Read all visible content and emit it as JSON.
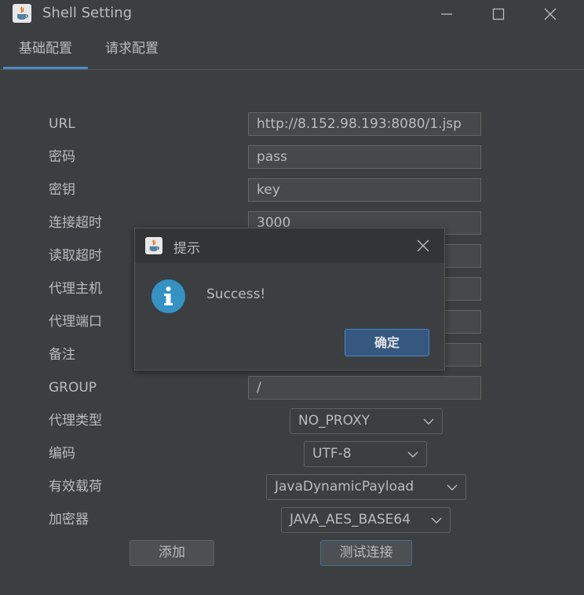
{
  "window": {
    "title": "Shell Setting"
  },
  "tabs": [
    {
      "label": "基础配置",
      "active": true
    },
    {
      "label": "请求配置",
      "active": false
    }
  ],
  "form": {
    "url": {
      "label": "URL",
      "value": "http://8.152.98.193:8080/1.jsp"
    },
    "password": {
      "label": "密码",
      "value": "pass"
    },
    "key": {
      "label": "密钥",
      "value": "key"
    },
    "conn_timeout": {
      "label": "连接超时",
      "value": "3000"
    },
    "read_timeout": {
      "label": "读取超时",
      "value": ""
    },
    "proxy_host": {
      "label": "代理主机",
      "value": ""
    },
    "proxy_port": {
      "label": "代理端口",
      "value": ""
    },
    "remark": {
      "label": "备注",
      "value": ""
    },
    "group": {
      "label": "GROUP",
      "value": "/"
    },
    "proxy_type": {
      "label": "代理类型",
      "selected": "NO_PROXY"
    },
    "encoding": {
      "label": "编码",
      "selected": "UTF-8"
    },
    "payload": {
      "label": "有效载荷",
      "selected": "JavaDynamicPayload"
    },
    "cryption": {
      "label": "加密器",
      "selected": "JAVA_AES_BASE64"
    }
  },
  "buttons": {
    "add": "添加",
    "test": "测试连接"
  },
  "dialog": {
    "title": "提示",
    "message": "Success!",
    "ok": "确定",
    "icon": "info-icon"
  },
  "colors": {
    "background": "#3c3f41",
    "accent": "#4a88c7",
    "info": "#3592c4",
    "default_button": "#365880"
  }
}
